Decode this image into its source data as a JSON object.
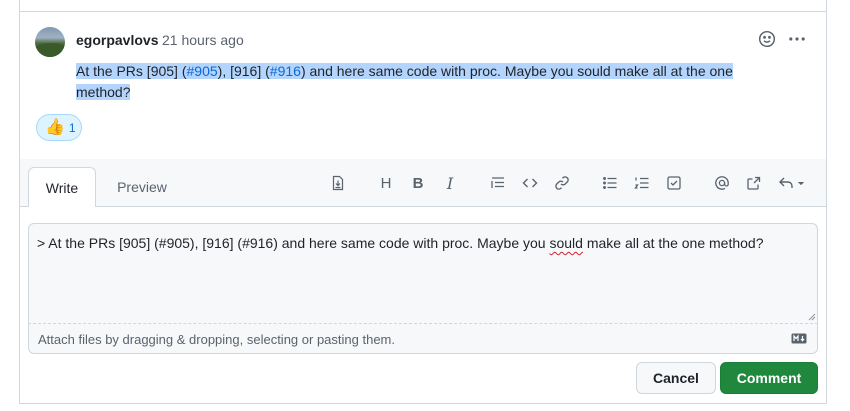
{
  "comment": {
    "author": "egorpavlovs",
    "time": "21 hours ago",
    "body_p1": "At the PRs [905] (",
    "link1": "#905",
    "body_p2": "), [916] (",
    "link2": "#916",
    "body_p3": ") and here same code with proc. Maybe you sould make all at the one method?",
    "reaction_emoji": "👍",
    "reaction_count": "1"
  },
  "editor": {
    "tab_write": "Write",
    "tab_preview": "Preview",
    "toolbar": {
      "heading_glyph": "H",
      "bold_glyph": "B",
      "italic_glyph": "I",
      "icons": [
        "insert-template-icon",
        "heading-icon",
        "bold-icon",
        "italic-icon",
        "quote-icon",
        "code-icon",
        "link-icon",
        "unordered-list-icon",
        "ordered-list-icon",
        "task-list-icon",
        "mention-icon",
        "cross-reference-icon",
        "reply-undo-icon"
      ]
    },
    "textarea_p1": "> At the PRs [905] (#905), [916] (#916) and here same code with proc. Maybe you ",
    "textarea_misspelled": "sould",
    "textarea_p2": " make all at the one method?",
    "attach_hint": "Attach files by dragging & dropping, selecting or pasting them.",
    "cancel_label": "Cancel",
    "comment_label": "Comment"
  },
  "colors": {
    "accent": "#0969da",
    "primary_button": "#1f883d",
    "selection": "#b3d4fc"
  }
}
